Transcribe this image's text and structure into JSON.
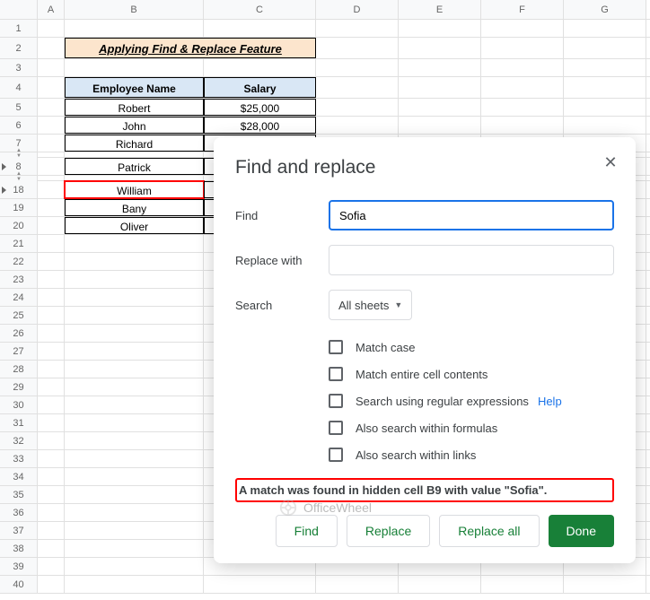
{
  "columns": [
    "A",
    "B",
    "C",
    "D",
    "E",
    "F",
    "G"
  ],
  "rows": [
    "1",
    "2",
    "3",
    "4",
    "5",
    "6",
    "7",
    "8",
    "18",
    "19",
    "20",
    "21",
    "22",
    "23",
    "24",
    "25",
    "26",
    "27",
    "28",
    "29",
    "30",
    "31",
    "32",
    "33",
    "34",
    "35",
    "36",
    "37",
    "38",
    "39",
    "40"
  ],
  "title": "Applying Find & Replace Feature",
  "table": {
    "headers": {
      "name": "Employee Name",
      "salary": "Salary"
    },
    "data": [
      {
        "name": "Robert",
        "salary": "$25,000"
      },
      {
        "name": "John",
        "salary": "$28,000"
      },
      {
        "name": "Richard",
        "salary": ""
      },
      {
        "name": "Patrick",
        "salary": ""
      },
      {
        "name": "William",
        "salary": ""
      },
      {
        "name": "Bany",
        "salary": ""
      },
      {
        "name": "Oliver",
        "salary": ""
      }
    ]
  },
  "dialog": {
    "title": "Find and replace",
    "find_label": "Find",
    "find_value": "Sofia",
    "replace_label": "Replace with",
    "replace_value": "",
    "search_label": "Search",
    "search_scope": "All sheets",
    "options": {
      "match_case": "Match case",
      "match_entire": "Match entire cell contents",
      "regex": "Search using regular expressions",
      "help": "Help",
      "formulas": "Also search within formulas",
      "links": "Also search within links"
    },
    "status": "A match was found in hidden cell B9 with value \"Sofia\".",
    "buttons": {
      "find": "Find",
      "replace": "Replace",
      "replace_all": "Replace all",
      "done": "Done"
    }
  },
  "watermark": "OfficeWheel"
}
